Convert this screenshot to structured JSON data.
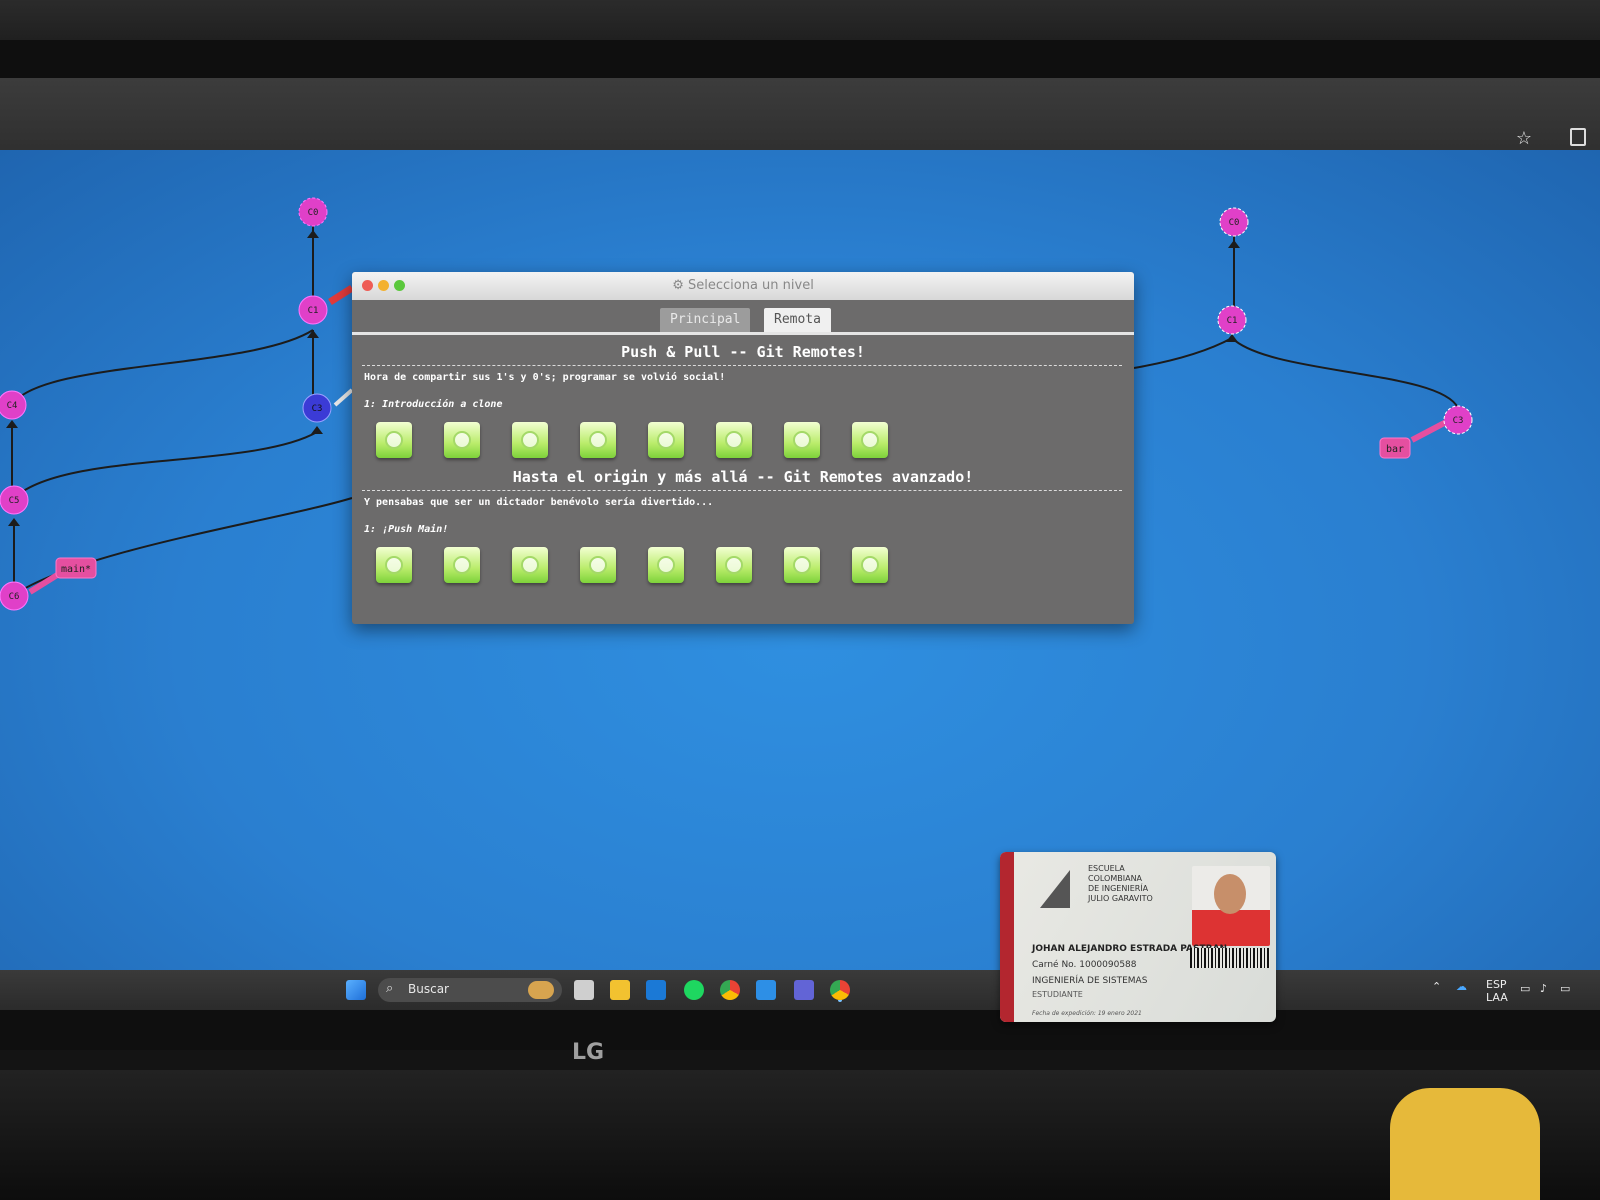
{
  "dialog": {
    "title": "Selecciona un nivel",
    "tabs": [
      {
        "label": "Principal",
        "active": false
      },
      {
        "label": "Remota",
        "active": true
      }
    ],
    "sections": [
      {
        "title": "Push & Pull -- Git Remotes!",
        "about": "Hora de compartir sus 1's y 0's; programar se volvió social!",
        "sequence": "1: Introducción a clone",
        "level_count": 8,
        "completed": 8
      },
      {
        "title": "Hasta el origin y más allá -- Git Remotes avanzado!",
        "about": "Y pensabas que ser un dictador benévolo sería divertido...",
        "sequence": "1: ¡Push Main!",
        "level_count": 8,
        "completed": 8
      }
    ]
  },
  "graph": {
    "local_commits": [
      "C0",
      "C1",
      "C3",
      "C4",
      "C5",
      "C6"
    ],
    "local_branch": "main*",
    "remote_commits": [
      "C0",
      "C1",
      "C3"
    ],
    "remote_branch": "bar"
  },
  "taskbar": {
    "search_label": "Buscar",
    "language": "ESP",
    "layout": "LAA",
    "apps": [
      "windows-start",
      "task-view",
      "file-explorer",
      "outlook",
      "spotify",
      "chrome",
      "vscode",
      "teams",
      "chrome-active"
    ]
  },
  "monitor_brand": "LG",
  "id_card": {
    "school": "ESCUELA\nCOLOMBIANA\nDE INGENIERÍA\nJULIO GARAVITO",
    "name": "JOHAN ALEJANDRO ESTRADA PASTRAN",
    "carne": "Carné No. 1000090588",
    "program": "INGENIERÍA DE SISTEMAS",
    "role": "ESTUDIANTE",
    "issued": "Fecha de expedición: 19 enero 2021"
  },
  "colors": {
    "desktop_blue": "#2a7fd0",
    "commit_pink": "#e040c8",
    "commit_blue": "#3b3bd6",
    "branch_tag": "#e54fa0",
    "level_green": "#a6e35a",
    "dialog_bg": "#6c6b6b"
  }
}
